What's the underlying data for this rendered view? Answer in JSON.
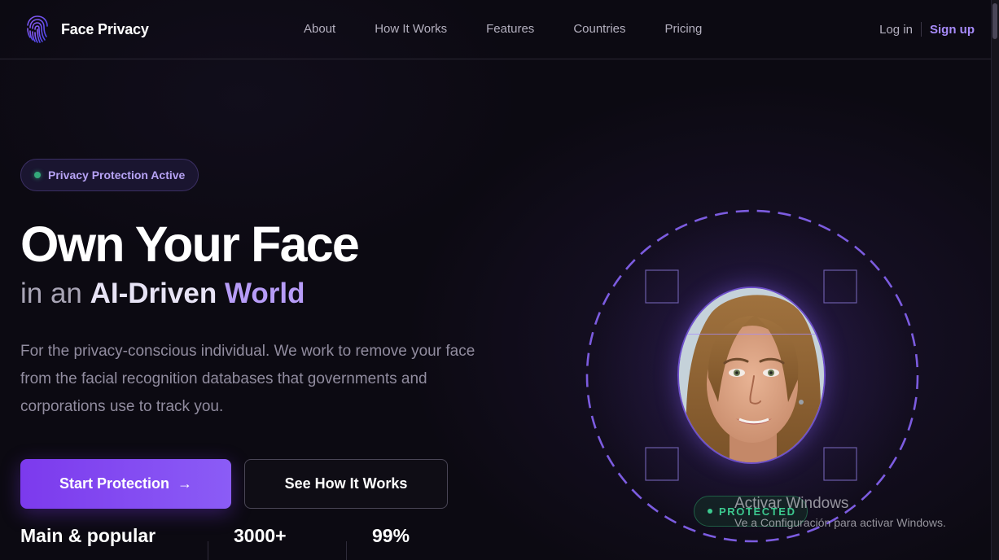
{
  "brand": {
    "name": "Face Privacy",
    "icon": "fingerprint-icon"
  },
  "nav": {
    "links": [
      {
        "label": "About"
      },
      {
        "label": "How It Works"
      },
      {
        "label": "Features"
      },
      {
        "label": "Countries"
      },
      {
        "label": "Pricing"
      }
    ],
    "login": "Log in",
    "signup": "Sign up"
  },
  "hero": {
    "badge": "Privacy Protection Active",
    "title": "Own Your Face",
    "subtitle": {
      "prefix": "in an ",
      "strong": "AI-Driven",
      "accent": "World"
    },
    "description": "For the privacy-conscious individual. We work to remove your face from the facial recognition databases that governments and corporations use to track you.",
    "cta_primary": "Start Protection",
    "cta_primary_icon": "arrow-right-icon",
    "cta_secondary": "See How It Works",
    "stats": [
      {
        "value": "Main & popular"
      },
      {
        "value": "3000+"
      },
      {
        "value": "99%"
      }
    ]
  },
  "visual": {
    "status": "PROTECTED"
  },
  "watermark": {
    "title": "Activar Windows",
    "subtitle": "Ve a Configuración para activar Windows."
  },
  "colors": {
    "background": "#0c0a12",
    "accent": "#8b5cf6",
    "accent_text": "#a78bfa",
    "status_green": "#3cc98f"
  }
}
